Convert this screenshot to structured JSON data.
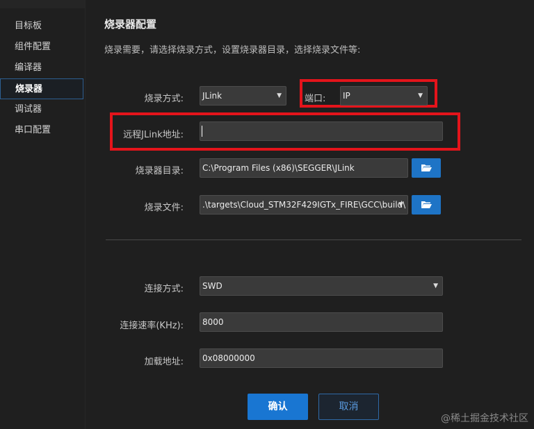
{
  "sidebar": {
    "items": [
      {
        "label": "目标板"
      },
      {
        "label": "组件配置"
      },
      {
        "label": "编译器"
      },
      {
        "label": "烧录器",
        "active": true
      },
      {
        "label": "调试器"
      },
      {
        "label": "串口配置"
      }
    ]
  },
  "header": {
    "title": "烧录器配置",
    "subtitle": "烧录需要，请选择烧录方式，设置烧录器目录，选择烧录文件等:"
  },
  "form": {
    "burn_method": {
      "label": "烧录方式:",
      "value": "JLink"
    },
    "port": {
      "label": "端口:",
      "value": "IP"
    },
    "remote_address": {
      "label": "远程JLink地址:",
      "value": ""
    },
    "burner_dir": {
      "label": "烧录器目录:",
      "value": "C:\\Program Files (x86)\\SEGGER\\JLink"
    },
    "burn_file": {
      "label": "烧录文件:",
      "value": ".\\targets\\Cloud_STM32F429IGTx_FIRE\\GCC\\build\\"
    },
    "connect_method": {
      "label": "连接方式:",
      "value": "SWD"
    },
    "connect_speed": {
      "label": "连接速率(KHz):",
      "value": "8000"
    },
    "load_address": {
      "label": "加载地址:",
      "value": "0x08000000"
    }
  },
  "buttons": {
    "ok": "确认",
    "cancel": "取消"
  },
  "watermark": "@稀土掘金技术社区",
  "colors": {
    "background": "#1f1f1f",
    "accent": "#1976d2",
    "highlight_box": "#e4141b"
  }
}
